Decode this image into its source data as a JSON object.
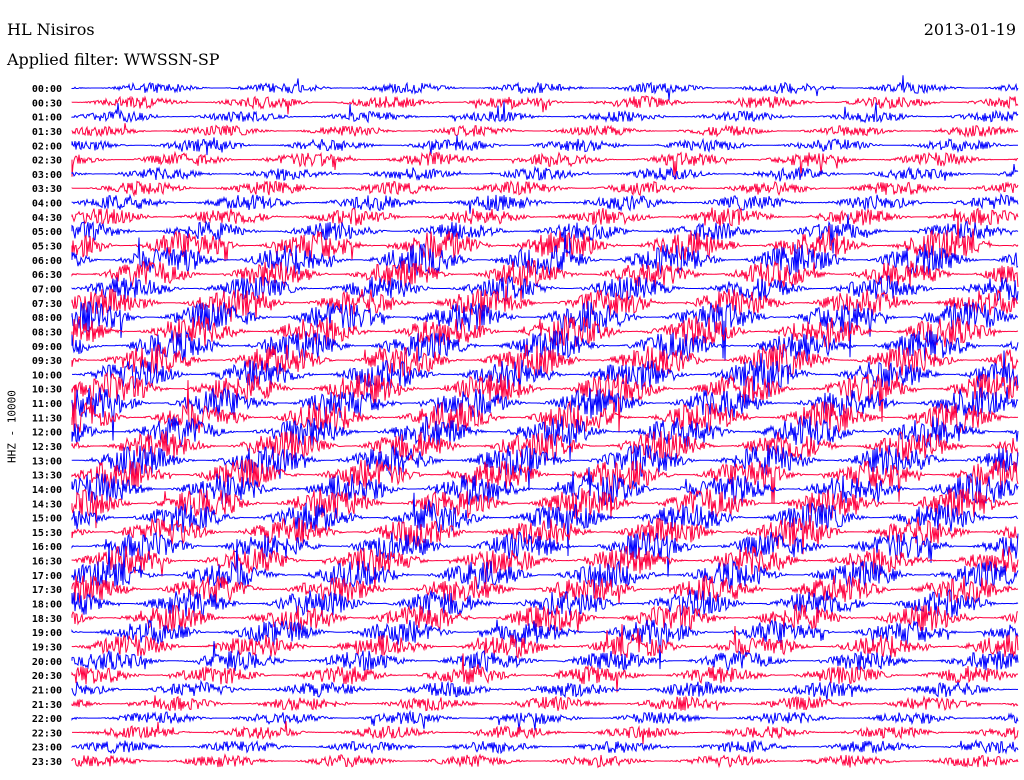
{
  "header": {
    "title": "HL Nisiros",
    "filter": "Applied filter: WWSSN-SP",
    "date": "2013-01-19"
  },
  "chart_data": {
    "type": "line",
    "title": "HL Nisiros",
    "subtitle": "Applied filter: WWSSN-SP",
    "date": "2013-01-19",
    "ylabel": "HHZ - 10000",
    "row_labels": [
      "00:00",
      "00:30",
      "01:00",
      "01:30",
      "02:00",
      "02:30",
      "03:00",
      "03:30",
      "04:00",
      "04:30",
      "05:00",
      "05:30",
      "06:00",
      "06:30",
      "07:00",
      "07:30",
      "08:00",
      "08:30",
      "09:00",
      "09:30",
      "10:00",
      "10:30",
      "11:00",
      "11:30",
      "12:00",
      "12:30",
      "13:00",
      "13:30",
      "14:00",
      "14:30",
      "15:00",
      "15:30",
      "16:00",
      "16:30",
      "17:00",
      "17:30",
      "18:00",
      "18:30",
      "19:00",
      "19:30",
      "20:00",
      "20:30",
      "21:00",
      "21:30",
      "22:00",
      "22:30",
      "23:00",
      "23:30"
    ],
    "series_colors": [
      "#0000ff",
      "#ff0040"
    ],
    "relative_amplitude": [
      0.35,
      0.4,
      0.35,
      0.35,
      0.4,
      0.45,
      0.4,
      0.45,
      0.5,
      0.55,
      0.6,
      1.0,
      1.0,
      0.9,
      0.8,
      0.9,
      1.0,
      1.0,
      1.0,
      1.0,
      1.0,
      1.0,
      1.0,
      1.0,
      1.0,
      1.0,
      1.0,
      1.0,
      1.0,
      1.0,
      0.95,
      0.95,
      0.9,
      0.9,
      0.9,
      0.9,
      0.9,
      0.85,
      0.8,
      0.75,
      0.65,
      0.6,
      0.5,
      0.45,
      0.4,
      0.4,
      0.4,
      0.4
    ]
  }
}
